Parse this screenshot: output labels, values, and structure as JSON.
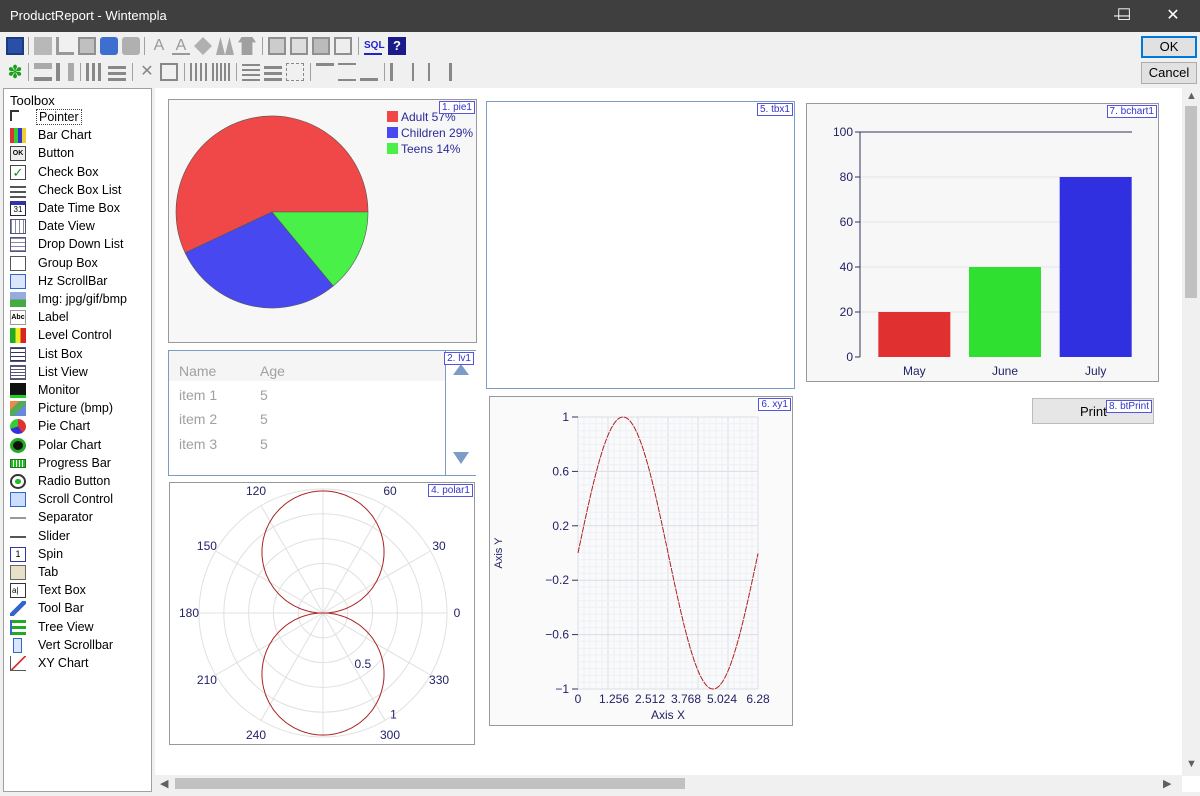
{
  "window": {
    "title": "ProductReport  -  Wintempla",
    "minimize_glyph": "—",
    "maximize_glyph": "☐",
    "close_glyph": "✕"
  },
  "dialog": {
    "ok_label": "OK",
    "cancel_label": "Cancel"
  },
  "toolbar": {
    "sql_label": "SQL",
    "help_label": "?"
  },
  "toolbox": {
    "title": "Toolbox",
    "items": [
      {
        "label": "Pointer",
        "icon": "pointer-icon"
      },
      {
        "label": "Bar Chart",
        "icon": "bar-chart-icon"
      },
      {
        "label": "Button",
        "icon": "button-icon"
      },
      {
        "label": "Check Box",
        "icon": "check-box-icon"
      },
      {
        "label": "Check Box List",
        "icon": "check-box-list-icon"
      },
      {
        "label": "Date Time Box",
        "icon": "calendar-icon"
      },
      {
        "label": "Date View",
        "icon": "date-view-icon"
      },
      {
        "label": "Drop Down List",
        "icon": "drop-down-icon"
      },
      {
        "label": "Group Box",
        "icon": "group-box-icon"
      },
      {
        "label": "Hz ScrollBar",
        "icon": "hscrollbar-icon"
      },
      {
        "label": "Img: jpg/gif/bmp",
        "icon": "image-icon"
      },
      {
        "label": "Label",
        "icon": "label-icon"
      },
      {
        "label": "Level Control",
        "icon": "level-icon"
      },
      {
        "label": "List Box",
        "icon": "list-box-icon"
      },
      {
        "label": "List View",
        "icon": "list-view-icon"
      },
      {
        "label": "Monitor",
        "icon": "monitor-icon"
      },
      {
        "label": "Picture (bmp)",
        "icon": "picture-icon"
      },
      {
        "label": "Pie Chart",
        "icon": "pie-chart-icon"
      },
      {
        "label": "Polar Chart",
        "icon": "polar-chart-icon"
      },
      {
        "label": "Progress Bar",
        "icon": "progress-bar-icon"
      },
      {
        "label": "Radio Button",
        "icon": "radio-button-icon"
      },
      {
        "label": "Scroll Control",
        "icon": "scroll-control-icon"
      },
      {
        "label": "Separator",
        "icon": "separator-icon"
      },
      {
        "label": "Slider",
        "icon": "slider-icon"
      },
      {
        "label": "Spin",
        "icon": "spin-icon"
      },
      {
        "label": "Tab",
        "icon": "tab-icon"
      },
      {
        "label": "Text Box",
        "icon": "text-box-icon"
      },
      {
        "label": "Tool Bar",
        "icon": "wrench-icon"
      },
      {
        "label": "Tree View",
        "icon": "tree-view-icon"
      },
      {
        "label": "Vert Scrollbar",
        "icon": "vscrollbar-icon"
      },
      {
        "label": "XY Chart",
        "icon": "xy-chart-icon"
      }
    ],
    "selected": "Pointer",
    "icon_text": {
      "button": "OK",
      "calendar": "31",
      "label": "Abc",
      "text_box": "a|"
    }
  },
  "controls": {
    "pie": {
      "tag": "1. pie1"
    },
    "listview": {
      "tag": "2. lv1",
      "columns": [
        "Name",
        "Age"
      ],
      "rows": [
        [
          "item 1",
          "5"
        ],
        [
          "item 2",
          "5"
        ],
        [
          "item 3",
          "5"
        ]
      ]
    },
    "polar": {
      "tag": "4. polar1"
    },
    "textbox": {
      "tag": "5. tbx1"
    },
    "xy": {
      "tag": "6. xy1"
    },
    "barchart": {
      "tag": "7. bchart1"
    },
    "print_button": {
      "tag": "8. btPrint",
      "label": "Print"
    }
  },
  "chart_data": [
    {
      "type": "pie",
      "slices": [
        {
          "label": "Adult",
          "percent": 57,
          "color": "#f04848"
        },
        {
          "label": "Children",
          "percent": 29,
          "color": "#4848f0"
        },
        {
          "label": "Teens",
          "percent": 14,
          "color": "#48f048"
        }
      ],
      "legend_labels": [
        "Adult 57%",
        "Children 29%",
        "Teens 14%"
      ],
      "legend": "top-right"
    },
    {
      "type": "line",
      "subtype": "polar",
      "angle_ticks": [
        "0",
        "30",
        "60",
        "120",
        "150",
        "180",
        "210",
        "240",
        "300",
        "330"
      ],
      "radius_ticks": [
        "0.5",
        "1"
      ],
      "rmax": 1,
      "curve": "r = |sin(theta)|",
      "color": "#aa2222",
      "grid": true
    },
    {
      "type": "line",
      "xlabel": "Axis X",
      "ylabel": "Axis Y",
      "xlim": [
        0,
        6.28
      ],
      "ylim": [
        -1,
        1
      ],
      "xticks": [
        "0",
        "1.256",
        "2.512",
        "3.768",
        "5.024",
        "6.28"
      ],
      "yticks": [
        "1",
        "0.6",
        "0.2",
        "−0.2",
        "−0.6",
        "−1"
      ],
      "series": [
        {
          "x": [
            0,
            0.314,
            0.628,
            0.942,
            1.256,
            1.57,
            1.884,
            2.198,
            2.512,
            2.826,
            3.14,
            3.454,
            3.768,
            4.082,
            4.396,
            4.71,
            5.024,
            5.338,
            5.652,
            5.966,
            6.28
          ],
          "y": [
            0,
            0.31,
            0.59,
            0.81,
            0.95,
            1,
            0.95,
            0.81,
            0.59,
            0.31,
            0,
            -0.31,
            -0.59,
            -0.81,
            -0.95,
            -1,
            -0.95,
            -0.81,
            -0.59,
            -0.31,
            0
          ]
        }
      ],
      "color": "#aa2222",
      "grid": true
    },
    {
      "type": "bar",
      "categories": [
        "May",
        "June",
        "July"
      ],
      "values": [
        20,
        40,
        80
      ],
      "colors": [
        "#e03030",
        "#30e030",
        "#3030e0"
      ],
      "ylim": [
        0,
        100
      ],
      "yticks": [
        "0",
        "20",
        "40",
        "60",
        "80",
        "100"
      ]
    }
  ]
}
